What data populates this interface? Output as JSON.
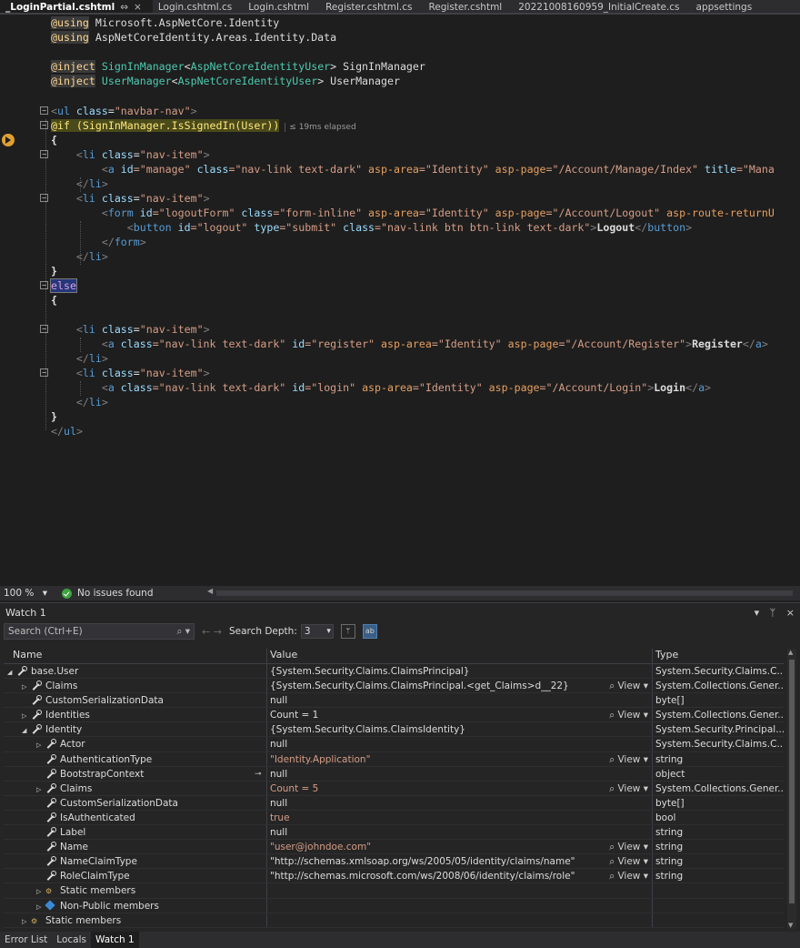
{
  "tabs": [
    {
      "label": "_LoginPartial.cshtml",
      "active": true
    },
    {
      "label": "Login.cshtml.cs"
    },
    {
      "label": "Login.cshtml"
    },
    {
      "label": "Register.cshtml.cs"
    },
    {
      "label": "Register.cshtml"
    },
    {
      "label": "20221008160959_InitialCreate.cs"
    },
    {
      "label": "appsettings"
    }
  ],
  "tab_controls": {
    "pin": "⇔",
    "close": "×"
  },
  "editor": {
    "elapsed": "≤ 19ms elapsed",
    "zoom": "100 %",
    "issues": "No issues found"
  },
  "watch": {
    "title": "Watch 1",
    "controls": {
      "dropdown": "▾",
      "pin": "ᛘ",
      "close": "×"
    },
    "search_placeholder": "Search (Ctrl+E)",
    "search_depth_label": "Search Depth:",
    "search_depth_value": "3",
    "columns": {
      "name": "Name",
      "value": "Value",
      "type": "Type"
    },
    "view_label": "View",
    "rows": [
      {
        "indent": 0,
        "exp": "open",
        "icon": "wrench",
        "name": "base.User",
        "value": "{System.Security.Claims.ClaimsPrincipal}",
        "type": "System.Security.Claims.C...",
        "red": false
      },
      {
        "indent": 1,
        "exp": "closed",
        "icon": "wrench",
        "name": "Claims",
        "value": "{System.Security.Claims.ClaimsPrincipal.<get_Claims>d__22}",
        "type": "System.Collections.Gener...",
        "view": true
      },
      {
        "indent": 1,
        "exp": "none",
        "icon": "wrench",
        "name": "CustomSerializationData",
        "value": "null",
        "type": "byte[]"
      },
      {
        "indent": 1,
        "exp": "closed",
        "icon": "wrench",
        "name": "Identities",
        "value": "Count = 1",
        "type": "System.Collections.Gener...",
        "view": true
      },
      {
        "indent": 1,
        "exp": "open",
        "icon": "wrench",
        "name": "Identity",
        "value": "{System.Security.Claims.ClaimsIdentity}",
        "type": "System.Security.Principal...."
      },
      {
        "indent": 2,
        "exp": "closed",
        "icon": "wrench",
        "name": "Actor",
        "value": "null",
        "type": "System.Security.Claims.C..."
      },
      {
        "indent": 2,
        "exp": "none",
        "icon": "wrench",
        "name": "AuthenticationType",
        "value": "\"Identity.Application\"",
        "type": "string",
        "red": true,
        "view": true
      },
      {
        "indent": 2,
        "exp": "none",
        "icon": "wrench",
        "name": "BootstrapContext",
        "value": "null",
        "type": "object",
        "pin": true
      },
      {
        "indent": 2,
        "exp": "closed",
        "icon": "wrench",
        "name": "Claims",
        "value": "Count = 5",
        "type": "System.Collections.Gener...",
        "red": true,
        "view": true
      },
      {
        "indent": 2,
        "exp": "none",
        "icon": "wrench",
        "name": "CustomSerializationData",
        "value": "null",
        "type": "byte[]"
      },
      {
        "indent": 2,
        "exp": "none",
        "icon": "wrench",
        "name": "IsAuthenticated",
        "value": "true",
        "type": "bool",
        "red": true
      },
      {
        "indent": 2,
        "exp": "none",
        "icon": "wrench",
        "name": "Label",
        "value": "null",
        "type": "string"
      },
      {
        "indent": 2,
        "exp": "none",
        "icon": "wrench",
        "name": "Name",
        "value": "\"user@johndoe.com\"",
        "type": "string",
        "red": true,
        "view": true
      },
      {
        "indent": 2,
        "exp": "none",
        "icon": "wrench",
        "name": "NameClaimType",
        "value": "\"http://schemas.xmlsoap.org/ws/2005/05/identity/claims/name\"",
        "type": "string",
        "view": true
      },
      {
        "indent": 2,
        "exp": "none",
        "icon": "wrench",
        "name": "RoleClaimType",
        "value": "\"http://schemas.microsoft.com/ws/2008/06/identity/claims/role\"",
        "type": "string",
        "view": true
      },
      {
        "indent": 2,
        "exp": "closed",
        "icon": "static",
        "name": "Static members",
        "value": "",
        "type": ""
      },
      {
        "indent": 2,
        "exp": "closed",
        "icon": "nonpub",
        "name": "Non-Public members",
        "value": "",
        "type": ""
      },
      {
        "indent": 1,
        "exp": "closed",
        "icon": "static",
        "name": "Static members",
        "value": "",
        "type": ""
      }
    ]
  },
  "bottom_tabs": [
    {
      "label": "Error List"
    },
    {
      "label": "Locals"
    },
    {
      "label": "Watch 1",
      "active": true
    }
  ],
  "code": {
    "using1_kw": "@using",
    "using1_ns": " Microsoft.AspNetCore.Identity",
    "using2_kw": "@using",
    "using2_ns": " AspNetCoreIdentity.Areas.Identity.Data",
    "inject1_kw": "@inject",
    "inject1_type": "SignInManager",
    "inject1_lt": "<",
    "inject1_arg": "AspNetCoreIdentityUser",
    "inject1_gt": ">",
    "inject1_name": " SignInManager",
    "inject2_kw": "@inject",
    "inject2_type": "UserManager",
    "inject2_lt": "<",
    "inject2_arg": "AspNetCoreIdentityUser",
    "inject2_gt": ">",
    "inject2_name": " UserManager",
    "ul_open_lt": "<",
    "ul_tag": "ul",
    "ul_attr": " class",
    "ul_eq": "=",
    "ul_val": "\"navbar-nav\"",
    "ul_gt": ">",
    "if_at": "@",
    "if_kw": "if",
    "if_expr": " (SignInManager.IsSignedIn(User))",
    "brace_open": "{",
    "brace_close": "}",
    "li_lt": "<",
    "li_tag": "li",
    "li_attr": " class",
    "li_eq": "=",
    "li_val": "\"nav-item\"",
    "li_gt": ">",
    "li_close": "</",
    "li_close_tag": "li",
    "li_close_gt": ">",
    "a1_lt": "<",
    "a1_tag": "a",
    "a1_id": " id",
    "a1_id_v": "=\"manage\"",
    "a1_cls": " class",
    "a1_cls_v": "=\"nav-link text-dark\"",
    "a1_area": " asp-area",
    "a1_area_v": "=\"Identity\"",
    "a1_page": " asp-page",
    "a1_page_v": "=\"/Account/Manage/Index\"",
    "a1_title": " title",
    "a1_title_v": "=\"Mana",
    "form_lt": "<",
    "form_tag": "form",
    "form_id": " id",
    "form_id_v": "=\"logoutForm\"",
    "form_cls": " class",
    "form_cls_v": "=\"form-inline\"",
    "form_area": " asp-area",
    "form_area_v": "=\"Identity\"",
    "form_page": " asp-page",
    "form_page_v": "=\"/Account/Logout\"",
    "form_route": " asp-route-returnU",
    "btn_lt": "<",
    "btn_tag": "button",
    "btn_id": " id",
    "btn_id_v": "=\"logout\"",
    "btn_type": " type",
    "btn_type_v": "=\"submit\"",
    "btn_cls": " class",
    "btn_cls_v": "=\"nav-link btn btn-link text-dark\"",
    "btn_gt": ">",
    "btn_text": "Logout",
    "btn_close": "</",
    "btn_close_tag": "button",
    "btn_close_gt": ">",
    "form_close": "</",
    "form_close_tag": "form",
    "form_close_gt": ">",
    "else_kw": "else",
    "a2_lt": "<",
    "a2_tag": "a",
    "a2_cls": " class",
    "a2_cls_v": "=\"nav-link text-dark\"",
    "a2_id": " id",
    "a2_id_v": "=\"register\"",
    "a2_area": " asp-area",
    "a2_area_v": "=\"Identity\"",
    "a2_page": " asp-page",
    "a2_page_v": "=\"/Account/Register\"",
    "a2_gt": ">",
    "a2_text": "Register",
    "a2_close": "</",
    "a2_close_tag": "a",
    "a2_close_gt": ">",
    "a3_lt": "<",
    "a3_tag": "a",
    "a3_cls": " class",
    "a3_cls_v": "=\"nav-link text-dark\"",
    "a3_id": " id",
    "a3_id_v": "=\"login\"",
    "a3_area": " asp-area",
    "a3_area_v": "=\"Identity\"",
    "a3_page": " asp-page",
    "a3_page_v": "=\"/Account/Login\"",
    "a3_gt": ">",
    "a3_text": "Login",
    "a3_close": "</",
    "a3_close_tag": "a",
    "a3_close_gt": ">",
    "ul_close": "</",
    "ul_close_tag": "ul",
    "ul_close_gt": ">"
  }
}
